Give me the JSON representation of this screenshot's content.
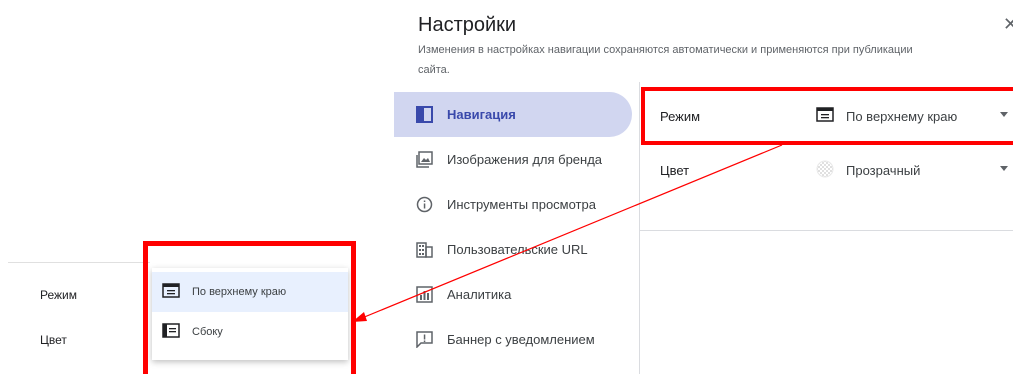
{
  "dialog": {
    "title": "Настройки",
    "subtitle": "Изменения в настройках навигации сохраняются автоматически и применяются при публикации сайта.",
    "close_icon": "close-icon"
  },
  "nav": {
    "items": [
      {
        "label": "Навигация",
        "icon": "navigation-panel-icon",
        "active": true
      },
      {
        "label": "Изображения для бренда",
        "icon": "brand-image-icon",
        "active": false
      },
      {
        "label": "Инструменты просмотра",
        "icon": "info-icon",
        "active": false
      },
      {
        "label": "Пользовательские URL",
        "icon": "building-icon",
        "active": false
      },
      {
        "label": "Аналитика",
        "icon": "analytics-icon",
        "active": false
      },
      {
        "label": "Баннер с уведомлением",
        "icon": "banner-alert-icon",
        "active": false
      }
    ]
  },
  "settings": {
    "mode": {
      "label": "Режим",
      "value": "По верхнему краю",
      "icon": "top-navigation-icon"
    },
    "color": {
      "label": "Цвет",
      "value": "Прозрачный",
      "icon": "transparent-swatch-icon"
    }
  },
  "zoom": {
    "mode_label": "Режим",
    "color_label": "Цвет",
    "options": [
      {
        "label": "По верхнему краю",
        "icon": "top-navigation-icon",
        "selected": true
      },
      {
        "label": "Сбоку",
        "icon": "side-navigation-icon",
        "selected": false
      }
    ]
  },
  "colors": {
    "accent": "#3949ab",
    "active_bg": "#d1d6f0",
    "highlight": "#ff0000",
    "menu_selected_bg": "#e8f0fe"
  }
}
